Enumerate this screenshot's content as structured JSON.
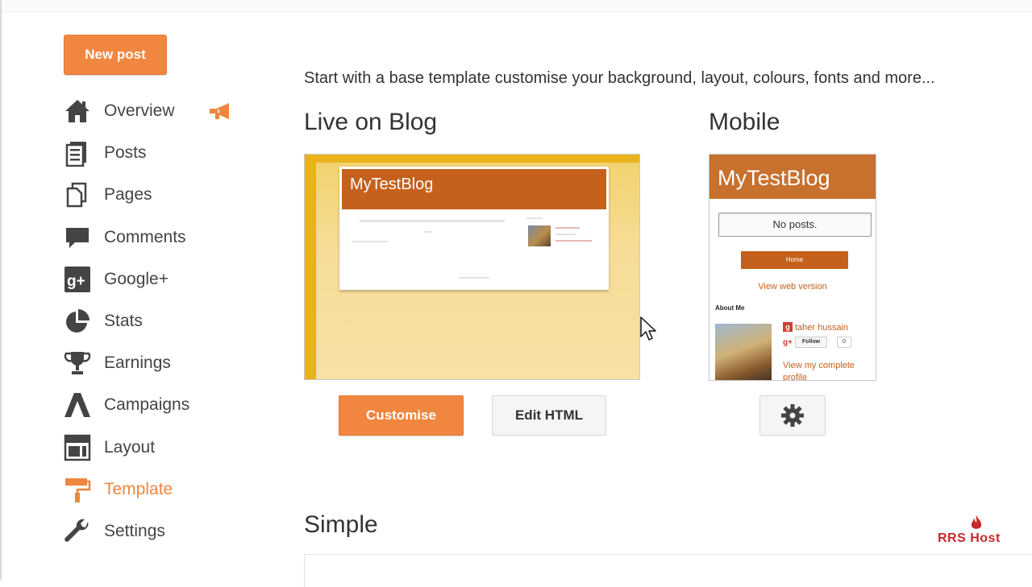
{
  "sidebar": {
    "new_post_label": "New post",
    "items": [
      {
        "label": "Overview",
        "icon": "home-icon"
      },
      {
        "label": "Posts",
        "icon": "posts-icon"
      },
      {
        "label": "Pages",
        "icon": "pages-icon"
      },
      {
        "label": "Comments",
        "icon": "comments-icon"
      },
      {
        "label": "Google+",
        "icon": "google-plus-icon"
      },
      {
        "label": "Stats",
        "icon": "stats-pie-icon"
      },
      {
        "label": "Earnings",
        "icon": "trophy-icon"
      },
      {
        "label": "Campaigns",
        "icon": "adwords-icon"
      },
      {
        "label": "Layout",
        "icon": "layout-icon"
      },
      {
        "label": "Template",
        "icon": "paint-roller-icon",
        "active": true
      },
      {
        "label": "Settings",
        "icon": "wrench-icon"
      }
    ]
  },
  "main": {
    "intro": "Start with a base template customise your background, layout, colours, fonts and more...",
    "live_title": "Live on Blog",
    "mobile_title": "Mobile",
    "simple_title": "Simple",
    "live_preview": {
      "blog_title": "MyTestBlog"
    },
    "mobile_preview": {
      "blog_title": "MyTestBlog",
      "no_posts": "No posts.",
      "home_button": "Home",
      "view_web": "View web version",
      "about_me": "About Me",
      "author": "taher hussain",
      "follow": "Follow",
      "follow_count": "0",
      "view_profile": "View my complete profile"
    },
    "buttons": {
      "customise": "Customise",
      "edit_html": "Edit HTML"
    }
  },
  "watermark": "RRS Host",
  "colors": {
    "accent": "#f0863f",
    "blog_header": "#c4611c",
    "mobile_header": "#c8702e",
    "live_bg": "#f6dc95"
  }
}
